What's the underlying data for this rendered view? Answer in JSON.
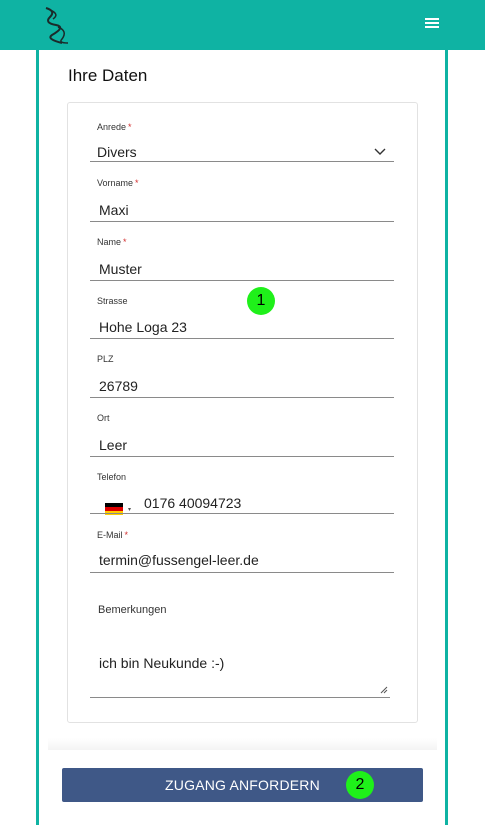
{
  "header": {
    "menu_icon": "hamburger-icon",
    "logo_icon": "fussengel-swirl-logo"
  },
  "section_title": "Ihre Daten",
  "form": {
    "anrede": {
      "label": "Anrede",
      "required": "*",
      "value": "Divers",
      "icon": "chevron-down-icon"
    },
    "vorname": {
      "label": "Vorname",
      "required": "*",
      "value": "Maxi"
    },
    "name": {
      "label": "Name",
      "required": "*",
      "value": "Muster"
    },
    "strasse": {
      "label": "Strasse",
      "value": "Hohe Loga 23"
    },
    "plz": {
      "label": "PLZ",
      "value": "26789"
    },
    "ort": {
      "label": "Ort",
      "value": "Leer"
    },
    "telefon": {
      "label": "Telefon",
      "value": "0176 40094723",
      "country_icon": "germany-flag-icon",
      "caret": "▾"
    },
    "email": {
      "label": "E-Mail",
      "required": "*",
      "value": "termin@fussengel-leer.de"
    },
    "bemerkungen": {
      "label": "Bemerkungen",
      "value": "ich bin Neukunde :-)"
    }
  },
  "submit_label": "ZUGANG ANFORDERN",
  "markers": [
    "1",
    "2"
  ],
  "colors": {
    "brand_teal": "#0fb3a3",
    "button_blue": "#3f5887",
    "required_red": "#d32f2f",
    "marker_green": "#1ff01a"
  }
}
